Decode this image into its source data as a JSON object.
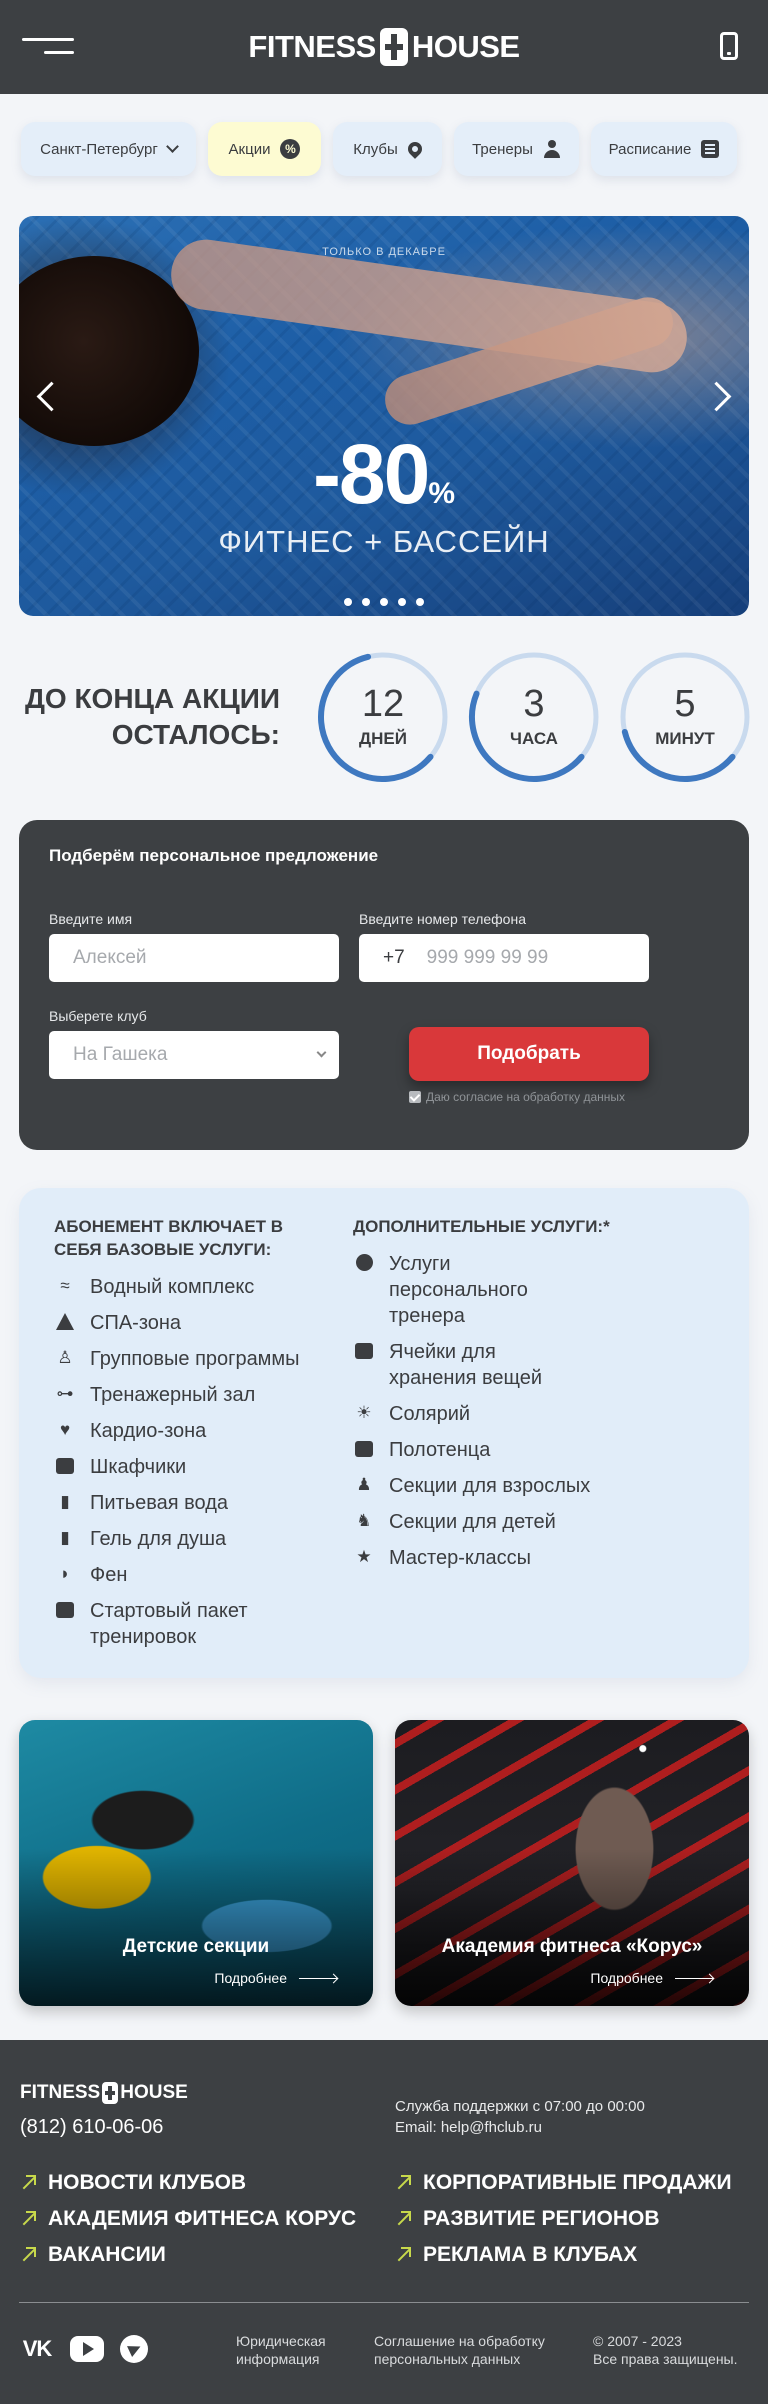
{
  "header": {
    "logo_left": "FITNESS",
    "logo_right": "HOUSE"
  },
  "nav": [
    {
      "label": "Санкт-Петербург",
      "icon": "chevron-down-icon"
    },
    {
      "label": "Акции",
      "icon": "percent-icon"
    },
    {
      "label": "Клубы",
      "icon": "map-pin-icon"
    },
    {
      "label": "Тренеры",
      "icon": "person-icon"
    },
    {
      "label": "Расписание",
      "icon": "list-icon"
    }
  ],
  "nav_pct_glyph": "%",
  "hero": {
    "kicker": "ТОЛЬКО В ДЕКАБРЕ",
    "discount": "-80",
    "percent": "%",
    "subtitle": "ФИТНЕС + БАССЕЙН",
    "slides": 5
  },
  "countdown": {
    "label": "ДО КОНЦА АКЦИИ ОСТАЛОСЬ:",
    "days": {
      "value": "12",
      "unit": "ДНЕЙ",
      "progress": 0.6
    },
    "hours": {
      "value": "3",
      "unit": "ЧАСА",
      "progress": 0.45
    },
    "minutes": {
      "value": "5",
      "unit": "МИНУТ",
      "progress": 0.35
    },
    "ring_color": "#3e78c0"
  },
  "form": {
    "title": "Подберём персональное предложение",
    "name_label": "Введите имя",
    "name_placeholder": "Алексей",
    "phone_label": "Введите номер телефона",
    "phone_prefix": "+7",
    "phone_placeholder": "999 999 99 99",
    "club_label": "Выберете клуб",
    "club_value": "На Гашека",
    "submit": "Подобрать",
    "consent": "Даю согласие на обработку данных",
    "accent": "#d9383a"
  },
  "services": {
    "base_title": "АБОНЕМЕНТ ВКЛЮЧАЕТ В СЕБЯ БАЗОВЫЕ УСЛУГИ:",
    "base": [
      {
        "label": "Водный комплекс",
        "icon": "swimmer-icon"
      },
      {
        "label": "СПА-зона",
        "icon": "spa-icon"
      },
      {
        "label": "Групповые программы",
        "icon": "group-icon"
      },
      {
        "label": "Тренажерный зал",
        "icon": "dumbbell-icon"
      },
      {
        "label": "Кардио-зона",
        "icon": "heart-icon"
      },
      {
        "label": "Шкафчики",
        "icon": "shirt-icon"
      },
      {
        "label": "Питьевая вода",
        "icon": "cup-icon"
      },
      {
        "label": "Гель для душа",
        "icon": "bottle-icon"
      },
      {
        "label": "Фен",
        "icon": "hairdryer-icon"
      },
      {
        "label": "Стартовый пакет тренировок",
        "icon": "bag-icon"
      }
    ],
    "extra_title": "ДОПОЛНИТЕЛЬНЫЕ УСЛУГИ:*",
    "extra": [
      {
        "label": "Услуги персонального тренера",
        "icon": "person-icon"
      },
      {
        "label": "Ячейки для хранения вещей",
        "icon": "locker-icon"
      },
      {
        "label": "Солярий",
        "icon": "sun-icon"
      },
      {
        "label": "Полотенца",
        "icon": "towel-icon"
      },
      {
        "label": "Секции для взрослых",
        "icon": "adults-icon"
      },
      {
        "label": "Секции для детей",
        "icon": "kids-icon"
      },
      {
        "label": "Мастер-классы",
        "icon": "star-icon"
      }
    ]
  },
  "cards": [
    {
      "title": "Детские секции",
      "more": "Подробнее"
    },
    {
      "title": "Академия фитнеса «Корус»",
      "more": "Подробнее"
    }
  ],
  "footer": {
    "logo_left": "FITNESS",
    "logo_right": "HOUSE",
    "phone": "(812) 610-06-06",
    "support": "Служба поддержки с 07:00 до 00:00",
    "email": "Email: help@fhclub.ru",
    "links_left": [
      "НОВОСТИ КЛУБОВ",
      "АКАДЕМИЯ ФИТНЕСА КОРУС",
      "ВАКАНСИИ"
    ],
    "links_right": [
      "КОРПОРАТИВНЫЕ ПРОДАЖИ",
      "РАЗВИТИЕ РЕГИОНОВ",
      "РЕКЛАМА В КЛУБАХ"
    ],
    "vk": "VK",
    "legal": "Юридическая информация",
    "agreement": "Соглашение на обработку персональных данных",
    "copyright": "© 2007 - 2023",
    "rights": "Все права защищены.",
    "link_arrow_color": "#c8d94b"
  }
}
